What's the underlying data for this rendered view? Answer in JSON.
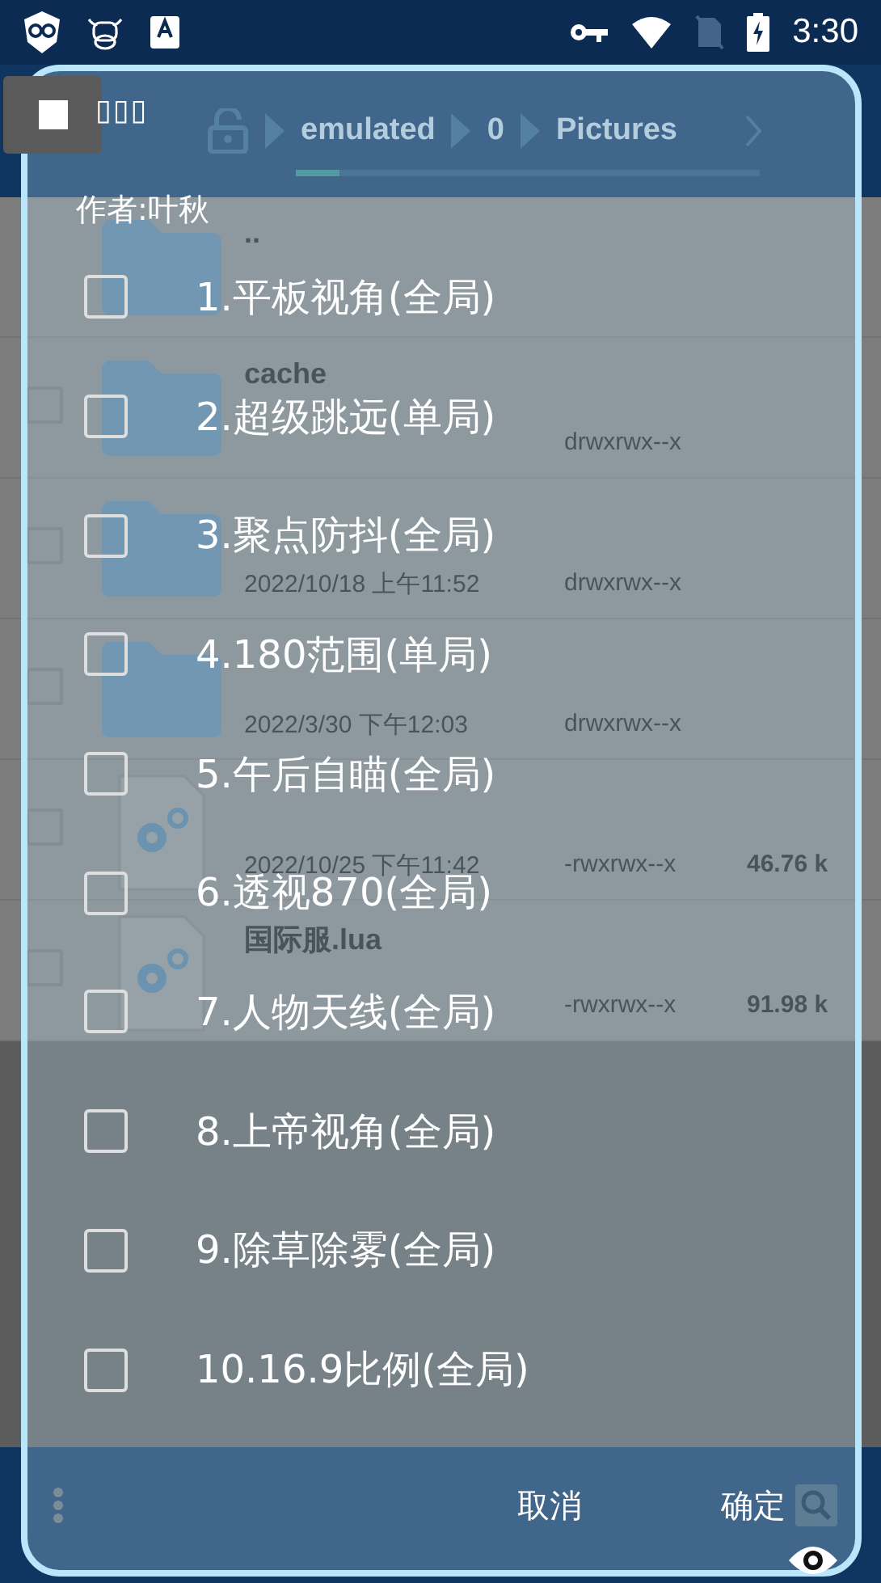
{
  "status_bar": {
    "time": "3:30"
  },
  "file_manager": {
    "path": [
      {
        "label": "emulated"
      },
      {
        "label": "0"
      },
      {
        "label": "Pictures"
      }
    ],
    "files": [
      {
        "kind": "parent",
        "name": ".."
      },
      {
        "kind": "folder",
        "checked": false,
        "name": "cache",
        "permissions": "drwxrwx--x"
      },
      {
        "kind": "folder",
        "checked": false,
        "date": "2022/10/18 上午11:52",
        "permissions": "drwxrwx--x"
      },
      {
        "kind": "folder",
        "checked": false,
        "date": "2022/3/30 下午12:03",
        "permissions": "drwxrwx--x"
      },
      {
        "kind": "script",
        "checked": false,
        "date": "2022/10/25 下午11:42",
        "permissions": "-rwxrwx--x",
        "size": "46.76 k"
      },
      {
        "kind": "script",
        "checked": false,
        "name": "国际服.lua",
        "permissions": "-rwxrwx--x",
        "size": "91.98 k"
      }
    ]
  },
  "dialog": {
    "title": "▯▯▯",
    "author": "作者:叶秋",
    "options": [
      {
        "label": "1.平板视角(全局)",
        "checked": false
      },
      {
        "label": "2.超级跳远(单局)",
        "checked": false
      },
      {
        "label": "3.聚点防抖(全局)",
        "checked": false
      },
      {
        "label": "4.180范围(单局)",
        "checked": false
      },
      {
        "label": "5.午后自瞄(全局)",
        "checked": false
      },
      {
        "label": "6.透视870(全局)",
        "checked": false
      },
      {
        "label": "7.人物天线(全局)",
        "checked": false
      },
      {
        "label": "8.上帝视角(全局)",
        "checked": false
      },
      {
        "label": "9.除草除雾(全局)",
        "checked": false
      },
      {
        "label": "10.16.9比例(全局)",
        "checked": false
      }
    ],
    "buttons": [
      {
        "label": "取消"
      },
      {
        "label": "确定"
      }
    ]
  }
}
